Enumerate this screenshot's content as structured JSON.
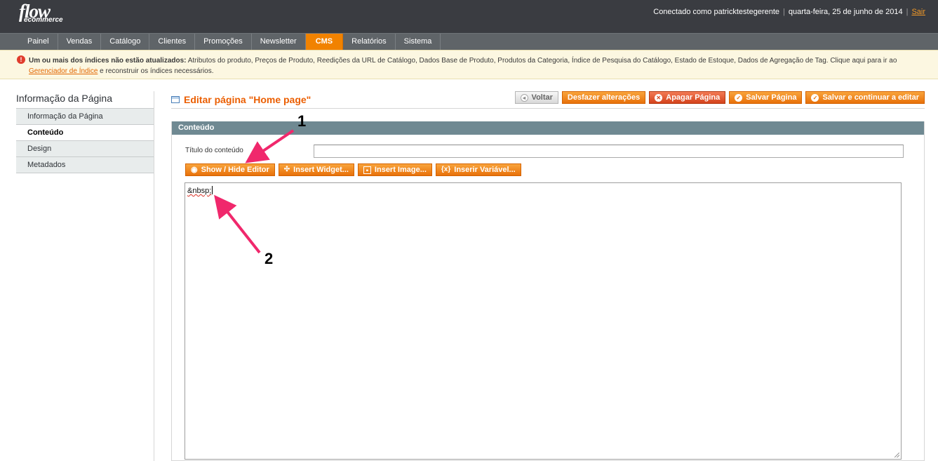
{
  "header": {
    "logo_main": "flow",
    "logo_sub": "ecommerce",
    "logged_in": "Conectado como patricktestegerente",
    "date": "quarta-feira, 25 de junho de 2014",
    "logout": "Sair"
  },
  "nav": {
    "items": [
      "Painel",
      "Vendas",
      "Catálogo",
      "Clientes",
      "Promoções",
      "Newsletter",
      "CMS",
      "Relatórios",
      "Sistema"
    ],
    "active": "CMS"
  },
  "message": {
    "bold": "Um ou mais dos índices não estão atualizados:",
    "text": " Atributos do produto, Preços de Produto, Reedições da URL de Catálogo, Dados Base de Produto, Produtos da Categoria, Índice de Pesquisa do Catálogo, Estado de Estoque, Dados de Agregação de Tag. Clique aqui para ir ao ",
    "link": "Gerenciador de Índice",
    "tail": " e reconstruir os índices necessários."
  },
  "sidebar": {
    "title": "Informação da Página",
    "items": [
      {
        "label": "Informação da Página",
        "active": false
      },
      {
        "label": "Conteúdo",
        "active": true
      },
      {
        "label": "Design",
        "active": false
      },
      {
        "label": "Metadados",
        "active": false
      }
    ]
  },
  "page": {
    "title": "Editar página \"Home page\"",
    "buttons": {
      "back": "Voltar",
      "reset": "Desfazer alterações",
      "delete": "Apagar Página",
      "save": "Salvar Página",
      "save_continue": "Salvar e continuar a editar"
    }
  },
  "content": {
    "section_title": "Conteúdo",
    "heading_label": "Título do conteúdo",
    "heading_value": "",
    "tools": {
      "show_hide": "Show / Hide Editor",
      "widget": "Insert Widget...",
      "image": "Insert Image...",
      "variable": "Inserir Variável..."
    },
    "editor_text": "&nbsp;"
  },
  "annotations": {
    "one": "1",
    "two": "2",
    "color": "#f0286c"
  }
}
